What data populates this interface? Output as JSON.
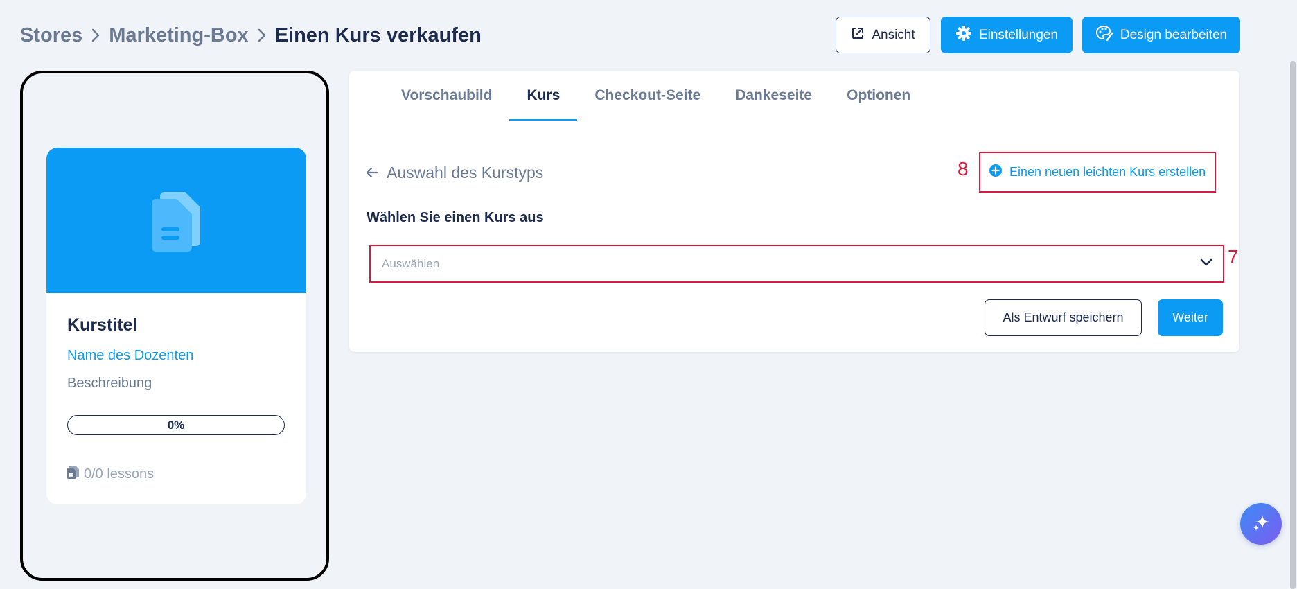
{
  "breadcrumb": {
    "items": [
      "Stores",
      "Marketing-Box"
    ],
    "current": "Einen Kurs verkaufen"
  },
  "header": {
    "view_label": "Ansicht",
    "settings_label": "Einstellungen",
    "design_label": "Design bearbeiten"
  },
  "preview": {
    "course_title": "Kurstitel",
    "teacher_name": "Name des Dozenten",
    "description": "Beschreibung",
    "progress": "0%",
    "lessons": "0/0 lessons"
  },
  "tabs": [
    "Vorschaubild",
    "Kurs",
    "Checkout-Seite",
    "Dankeseite",
    "Optionen"
  ],
  "active_tab": "Kurs",
  "main": {
    "back_label": "Auswahl des Kurstyps",
    "create_label": "Einen neuen leichten Kurs erstellen",
    "annotation_create": "8",
    "annotation_select": "7",
    "field_label": "Wählen Sie einen Kurs aus",
    "select_placeholder": "Auswählen",
    "draft_label": "Als Entwurf speichern",
    "next_label": "Weiter"
  },
  "colors": {
    "primary": "#0b9bf5",
    "dark": "#1d2b4f",
    "muted": "#6b7a93",
    "annotation": "#d81b3c",
    "background": "#f0f3f8"
  },
  "icons": [
    "chevron-right-icon",
    "external-link-icon",
    "gear-icon",
    "palette-icon",
    "document-icon",
    "arrow-left-icon",
    "plus-circle-icon",
    "chevron-down-icon",
    "sparkle-icon"
  ]
}
